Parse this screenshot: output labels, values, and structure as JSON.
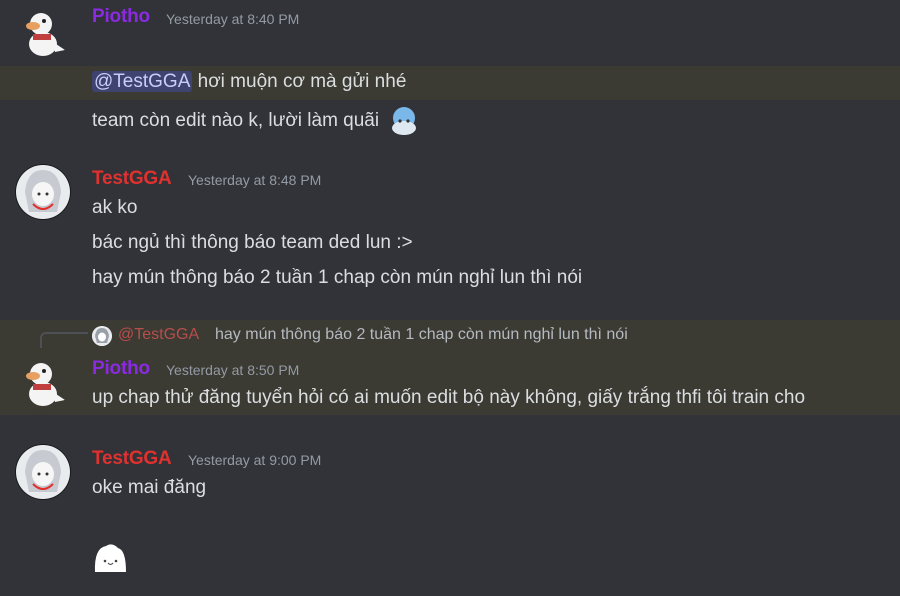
{
  "colors": {
    "piotho": "#8a2be2",
    "testgga": "#e0312f",
    "background": "#313338",
    "highlight": "#3b3a33"
  },
  "messages": [
    {
      "author": "Piotho",
      "timestamp": "Yesterday at 8:40 PM",
      "lines": [],
      "avatar": "duck-avatar"
    },
    {
      "author": "",
      "mention": "@TestGGA",
      "text": " hơi muộn cơ mà gửi nhé",
      "line2": "team còn edit nào k, lười làm quãi"
    },
    {
      "author": "TestGGA",
      "timestamp": "Yesterday at 8:48 PM",
      "lines": [
        "ak ko",
        "bác ngủ thì thông báo team ded lun :>",
        "hay mún thông báo 2 tuần 1 chap còn mún nghỉ lun thì nói"
      ],
      "avatar": "anime-avatar"
    },
    {
      "reply_to": "@TestGGA",
      "reply_text": "hay mún thông báo 2 tuần 1 chap còn mún nghỉ lun thì nói",
      "author": "Piotho",
      "timestamp": "Yesterday at 8:50 PM",
      "lines": [
        "up chap thử đăng tuyển hỏi có ai muốn edit bộ này không, giấy trắng thfi tôi train cho"
      ],
      "avatar": "duck-avatar"
    },
    {
      "author": "TestGGA",
      "timestamp": "Yesterday at 9:00 PM",
      "lines": [
        "oke mai đăng"
      ],
      "avatar": "anime-avatar",
      "sticker": "blob-sticker"
    }
  ]
}
